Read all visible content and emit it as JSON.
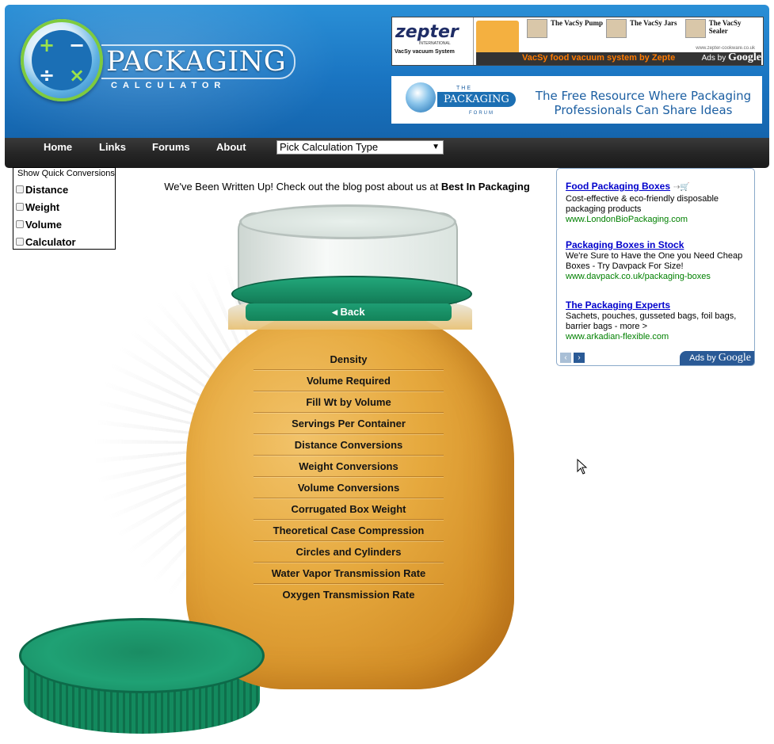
{
  "header": {
    "brand_word": "PACKAGING",
    "brand_sub": "CALCULATOR",
    "logo_symbols": [
      "+",
      "−",
      "÷",
      "×"
    ]
  },
  "top_ad": {
    "brand": "zepter",
    "brand_sub": "INTERNATIONAL",
    "left_caption": "VacSy vacuum System",
    "items": [
      "The VacSy Pump",
      "The VacSy Jars",
      "The VacSy Sealer"
    ],
    "tagline": "VacSy food vacuum system by Zepte",
    "url": "www.zepter-cookware.co.uk",
    "ads_by": "Ads by",
    "google": "Google"
  },
  "forum_ad": {
    "the": "THE",
    "word": "PACKAGING",
    "forum": "FORUM",
    "text": "The Free Resource Where Packaging Professionals Can Share Ideas"
  },
  "nav": {
    "links": [
      "Home",
      "Links",
      "Forums",
      "About"
    ],
    "select_value": "Pick Calculation Type"
  },
  "quick_conversions": {
    "title": "Show Quick Conversions",
    "options": [
      "Distance",
      "Weight",
      "Volume",
      "Calculator"
    ]
  },
  "writeup": {
    "text": "We've Been Written Up! Check out the blog post about us at",
    "link": "Best In Packaging"
  },
  "jar_menu": {
    "back": "Back",
    "items": [
      "Density",
      "Volume Required",
      "Fill Wt by Volume",
      "Servings Per Container",
      "Distance Conversions",
      "Weight Conversions",
      "Volume Conversions",
      "Corrugated Box Weight",
      "Theoretical Case Compression",
      "Circles and Cylinders",
      "Water Vapor Transmission Rate",
      "Oxygen Transmission Rate"
    ]
  },
  "side_ads": {
    "items": [
      {
        "title": "Food Packaging Boxes",
        "desc": "Cost-effective & eco-friendly disposable packaging products",
        "url": "www.LondonBioPackaging.com"
      },
      {
        "title": "Packaging Boxes in Stock",
        "desc": "We're Sure to Have the One you Need Cheap Boxes - Try Davpack For Size!",
        "url": "www.davpack.co.uk/packaging-boxes"
      },
      {
        "title": "The Packaging Experts",
        "desc": "Sachets, pouches, gusseted bags, foil bags, barrier bags - more >",
        "url": "www.arkadian-flexible.com"
      }
    ],
    "ads_by": "Ads by",
    "google": "Google"
  },
  "colors": {
    "header_blue": "#1a75c2",
    "navbar_dark": "#262626",
    "jar_green": "#1a9c70",
    "ad_link": "#0000cc",
    "ad_url": "#008000"
  }
}
